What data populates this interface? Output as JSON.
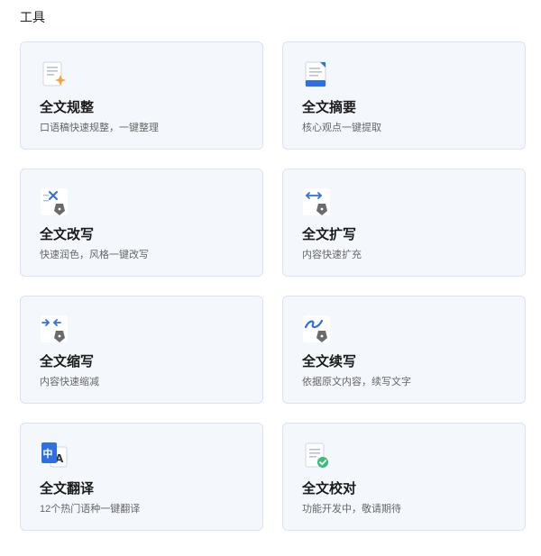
{
  "section": {
    "title": "工具"
  },
  "tools": [
    {
      "title": "全文规整",
      "desc": "口语稿快速规整，一键整理",
      "icon": "document-sparkle-icon"
    },
    {
      "title": "全文摘要",
      "desc": "核心观点一键提取",
      "icon": "document-summary-icon"
    },
    {
      "title": "全文改写",
      "desc": "快速润色，风格一键改写",
      "icon": "rewrite-pen-icon"
    },
    {
      "title": "全文扩写",
      "desc": "内容快速扩充",
      "icon": "expand-pen-icon"
    },
    {
      "title": "全文缩写",
      "desc": "内容快速缩减",
      "icon": "shrink-pen-icon"
    },
    {
      "title": "全文续写",
      "desc": "依据原文内容，续写文字",
      "icon": "continue-pen-icon"
    },
    {
      "title": "全文翻译",
      "desc": "12个热门语种一键翻译",
      "icon": "translate-icon"
    },
    {
      "title": "全文校对",
      "desc": "功能开发中，敬请期待",
      "icon": "proofread-check-icon"
    }
  ],
  "colors": {
    "accent_blue": "#2f6fe4",
    "accent_orange": "#f2a23a",
    "accent_green": "#3dbb7a",
    "card_bg": "#f4f7fc",
    "card_border": "#dce3f0"
  }
}
